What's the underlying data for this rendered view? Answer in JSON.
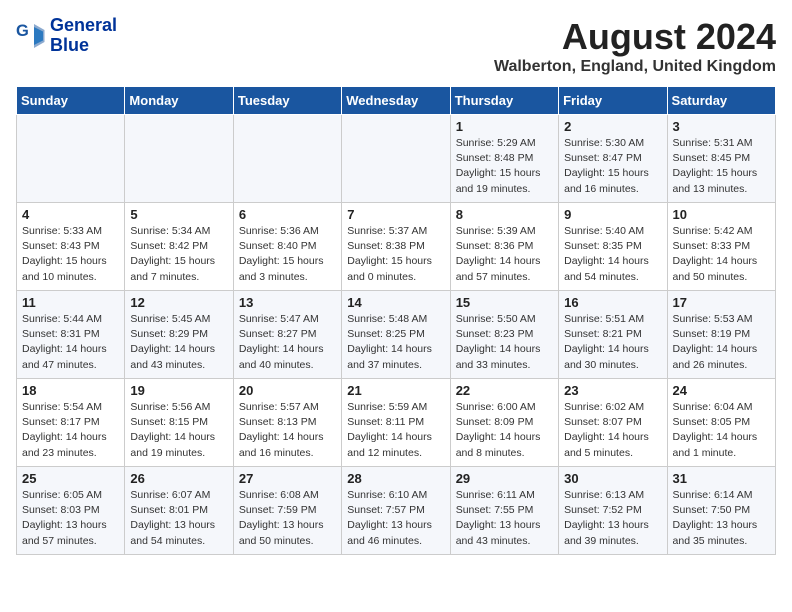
{
  "header": {
    "logo_line1": "General",
    "logo_line2": "Blue",
    "month_year": "August 2024",
    "location": "Walberton, England, United Kingdom"
  },
  "days_of_week": [
    "Sunday",
    "Monday",
    "Tuesday",
    "Wednesday",
    "Thursday",
    "Friday",
    "Saturday"
  ],
  "weeks": [
    [
      {
        "day": "",
        "info": ""
      },
      {
        "day": "",
        "info": ""
      },
      {
        "day": "",
        "info": ""
      },
      {
        "day": "",
        "info": ""
      },
      {
        "day": "1",
        "info": "Sunrise: 5:29 AM\nSunset: 8:48 PM\nDaylight: 15 hours\nand 19 minutes."
      },
      {
        "day": "2",
        "info": "Sunrise: 5:30 AM\nSunset: 8:47 PM\nDaylight: 15 hours\nand 16 minutes."
      },
      {
        "day": "3",
        "info": "Sunrise: 5:31 AM\nSunset: 8:45 PM\nDaylight: 15 hours\nand 13 minutes."
      }
    ],
    [
      {
        "day": "4",
        "info": "Sunrise: 5:33 AM\nSunset: 8:43 PM\nDaylight: 15 hours\nand 10 minutes."
      },
      {
        "day": "5",
        "info": "Sunrise: 5:34 AM\nSunset: 8:42 PM\nDaylight: 15 hours\nand 7 minutes."
      },
      {
        "day": "6",
        "info": "Sunrise: 5:36 AM\nSunset: 8:40 PM\nDaylight: 15 hours\nand 3 minutes."
      },
      {
        "day": "7",
        "info": "Sunrise: 5:37 AM\nSunset: 8:38 PM\nDaylight: 15 hours\nand 0 minutes."
      },
      {
        "day": "8",
        "info": "Sunrise: 5:39 AM\nSunset: 8:36 PM\nDaylight: 14 hours\nand 57 minutes."
      },
      {
        "day": "9",
        "info": "Sunrise: 5:40 AM\nSunset: 8:35 PM\nDaylight: 14 hours\nand 54 minutes."
      },
      {
        "day": "10",
        "info": "Sunrise: 5:42 AM\nSunset: 8:33 PM\nDaylight: 14 hours\nand 50 minutes."
      }
    ],
    [
      {
        "day": "11",
        "info": "Sunrise: 5:44 AM\nSunset: 8:31 PM\nDaylight: 14 hours\nand 47 minutes."
      },
      {
        "day": "12",
        "info": "Sunrise: 5:45 AM\nSunset: 8:29 PM\nDaylight: 14 hours\nand 43 minutes."
      },
      {
        "day": "13",
        "info": "Sunrise: 5:47 AM\nSunset: 8:27 PM\nDaylight: 14 hours\nand 40 minutes."
      },
      {
        "day": "14",
        "info": "Sunrise: 5:48 AM\nSunset: 8:25 PM\nDaylight: 14 hours\nand 37 minutes."
      },
      {
        "day": "15",
        "info": "Sunrise: 5:50 AM\nSunset: 8:23 PM\nDaylight: 14 hours\nand 33 minutes."
      },
      {
        "day": "16",
        "info": "Sunrise: 5:51 AM\nSunset: 8:21 PM\nDaylight: 14 hours\nand 30 minutes."
      },
      {
        "day": "17",
        "info": "Sunrise: 5:53 AM\nSunset: 8:19 PM\nDaylight: 14 hours\nand 26 minutes."
      }
    ],
    [
      {
        "day": "18",
        "info": "Sunrise: 5:54 AM\nSunset: 8:17 PM\nDaylight: 14 hours\nand 23 minutes."
      },
      {
        "day": "19",
        "info": "Sunrise: 5:56 AM\nSunset: 8:15 PM\nDaylight: 14 hours\nand 19 minutes."
      },
      {
        "day": "20",
        "info": "Sunrise: 5:57 AM\nSunset: 8:13 PM\nDaylight: 14 hours\nand 16 minutes."
      },
      {
        "day": "21",
        "info": "Sunrise: 5:59 AM\nSunset: 8:11 PM\nDaylight: 14 hours\nand 12 minutes."
      },
      {
        "day": "22",
        "info": "Sunrise: 6:00 AM\nSunset: 8:09 PM\nDaylight: 14 hours\nand 8 minutes."
      },
      {
        "day": "23",
        "info": "Sunrise: 6:02 AM\nSunset: 8:07 PM\nDaylight: 14 hours\nand 5 minutes."
      },
      {
        "day": "24",
        "info": "Sunrise: 6:04 AM\nSunset: 8:05 PM\nDaylight: 14 hours\nand 1 minute."
      }
    ],
    [
      {
        "day": "25",
        "info": "Sunrise: 6:05 AM\nSunset: 8:03 PM\nDaylight: 13 hours\nand 57 minutes."
      },
      {
        "day": "26",
        "info": "Sunrise: 6:07 AM\nSunset: 8:01 PM\nDaylight: 13 hours\nand 54 minutes."
      },
      {
        "day": "27",
        "info": "Sunrise: 6:08 AM\nSunset: 7:59 PM\nDaylight: 13 hours\nand 50 minutes."
      },
      {
        "day": "28",
        "info": "Sunrise: 6:10 AM\nSunset: 7:57 PM\nDaylight: 13 hours\nand 46 minutes."
      },
      {
        "day": "29",
        "info": "Sunrise: 6:11 AM\nSunset: 7:55 PM\nDaylight: 13 hours\nand 43 minutes."
      },
      {
        "day": "30",
        "info": "Sunrise: 6:13 AM\nSunset: 7:52 PM\nDaylight: 13 hours\nand 39 minutes."
      },
      {
        "day": "31",
        "info": "Sunrise: 6:14 AM\nSunset: 7:50 PM\nDaylight: 13 hours\nand 35 minutes."
      }
    ]
  ]
}
